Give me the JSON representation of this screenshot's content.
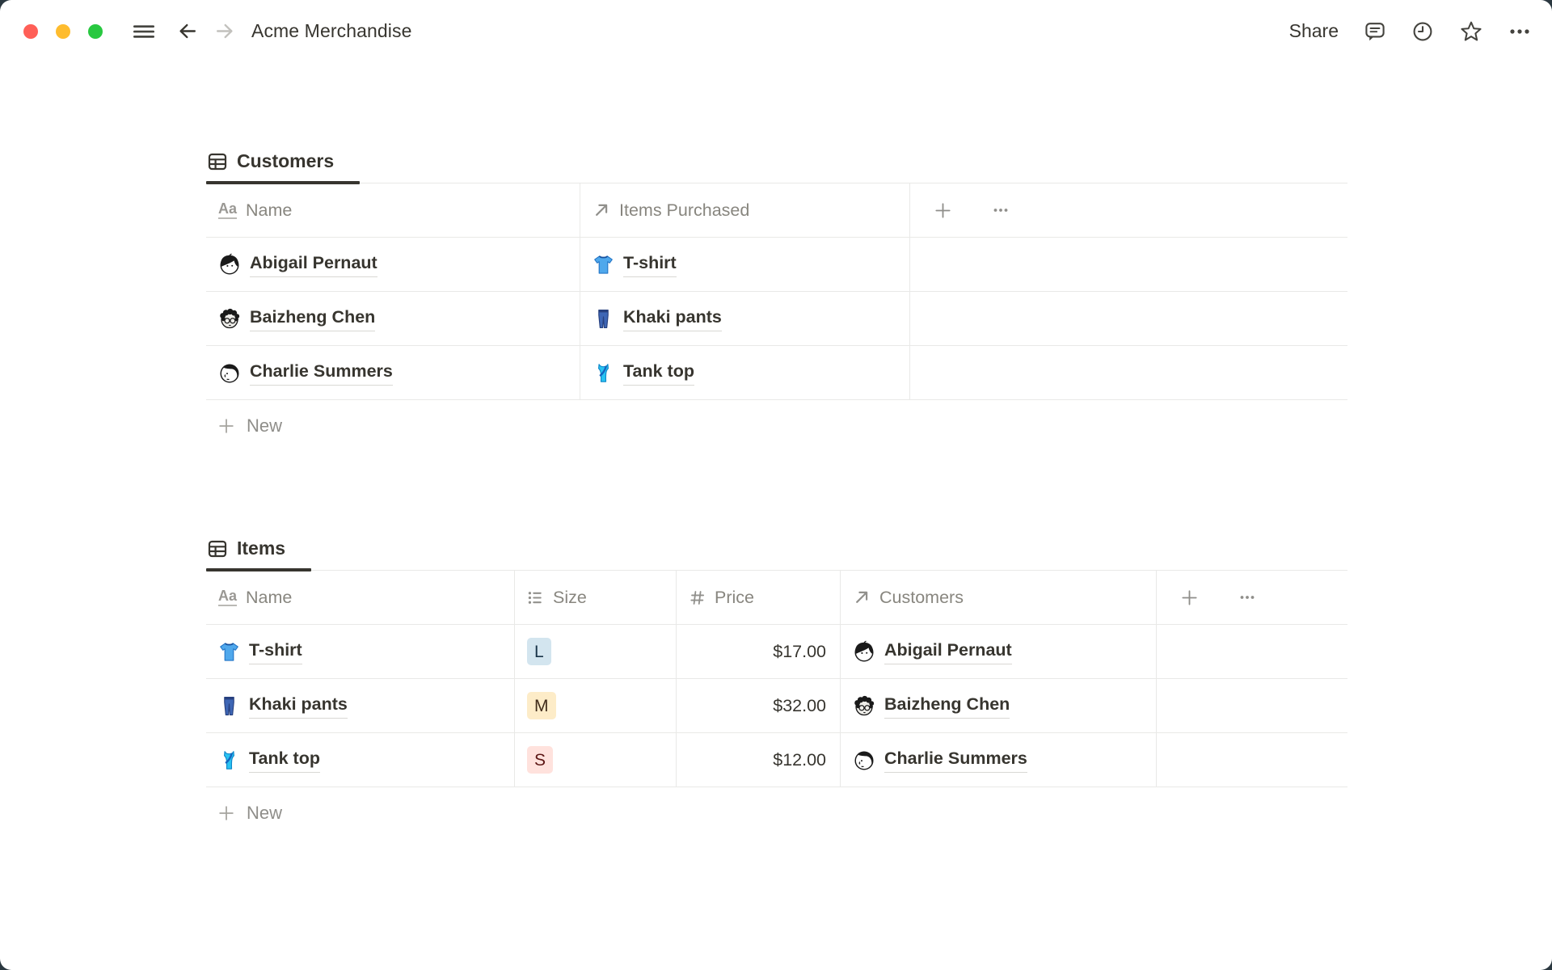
{
  "topbar": {
    "title": "Acme Merchandise",
    "share_label": "Share"
  },
  "customers_table": {
    "tab_label": "Customers",
    "columns": [
      {
        "label": "Name",
        "type": "text"
      },
      {
        "label": "Items Purchased",
        "type": "relation"
      }
    ],
    "rows": [
      {
        "name": "Abigail Pernaut",
        "item": "T-shirt"
      },
      {
        "name": "Baizheng Chen",
        "item": "Khaki pants"
      },
      {
        "name": "Charlie Summers",
        "item": "Tank top"
      }
    ],
    "new_row_label": "New"
  },
  "items_table": {
    "tab_label": "Items",
    "columns": [
      {
        "label": "Name",
        "type": "text"
      },
      {
        "label": "Size",
        "type": "select"
      },
      {
        "label": "Price",
        "type": "number"
      },
      {
        "label": "Customers",
        "type": "relation"
      }
    ],
    "rows": [
      {
        "name": "T-shirt",
        "size": "L",
        "size_tag_bg": "#D3E5EF",
        "size_tag_text": "#183347",
        "price": "$17.00",
        "customer": "Abigail Pernaut"
      },
      {
        "name": "Khaki pants",
        "size": "M",
        "size_tag_bg": "#FDECC8",
        "size_tag_text": "#402C1B",
        "price": "$32.00",
        "customer": "Baizheng Chen"
      },
      {
        "name": "Tank top",
        "size": "S",
        "size_tag_bg": "#FFE2DD",
        "size_tag_text": "#5D1715",
        "price": "$12.00",
        "customer": "Charlie Summers"
      }
    ],
    "new_row_label": "New"
  },
  "colors": {
    "text": "#37352F",
    "muted_text": "#88867F",
    "border": "#E9E9E7",
    "tab_indicator": "#37352F",
    "traffic_red": "#FF5F57",
    "traffic_yellow": "#FEBC2E",
    "traffic_green": "#28C840",
    "desktop_background": "#2B3840"
  }
}
